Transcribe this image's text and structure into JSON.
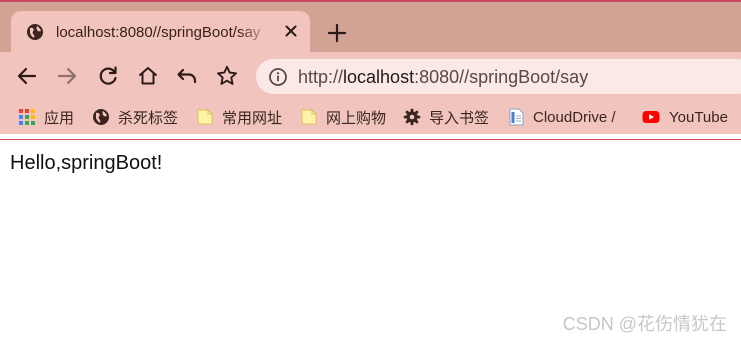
{
  "colors": {
    "tabstrip": "#d2a295",
    "active_tab": "#f1c5bd",
    "toolbar": "#f1c5bd",
    "omnibox": "#fae9e6",
    "accent_line": "#c9485f"
  },
  "tab": {
    "title": "localhost:8080//springBoot/say",
    "favicon": "globe-icon",
    "close_icon": "close-icon"
  },
  "toolbar": {
    "icons": [
      "back-arrow-icon",
      "forward-arrow-icon",
      "reload-icon",
      "home-icon",
      "undo-icon",
      "star-icon"
    ]
  },
  "omnibox": {
    "scheme": "http://",
    "host": "localhost",
    "path": ":8080//springBoot/say",
    "icon": "info-icon"
  },
  "bookmarks": [
    {
      "label": "应用",
      "icon": "apps-grid-icon"
    },
    {
      "label": "杀死标签",
      "icon": "globe-icon"
    },
    {
      "label": "常用网址",
      "icon": "folder-icon"
    },
    {
      "label": "网上购物",
      "icon": "folder-icon"
    },
    {
      "label": "导入书签",
      "icon": "gear-icon"
    },
    {
      "label": "CloudDrive /",
      "icon": "document-icon"
    },
    {
      "label": "YouTube",
      "icon": "youtube-icon"
    }
  ],
  "page": {
    "text": "Hello,springBoot!"
  },
  "watermark": "CSDN @花伤情犹在"
}
